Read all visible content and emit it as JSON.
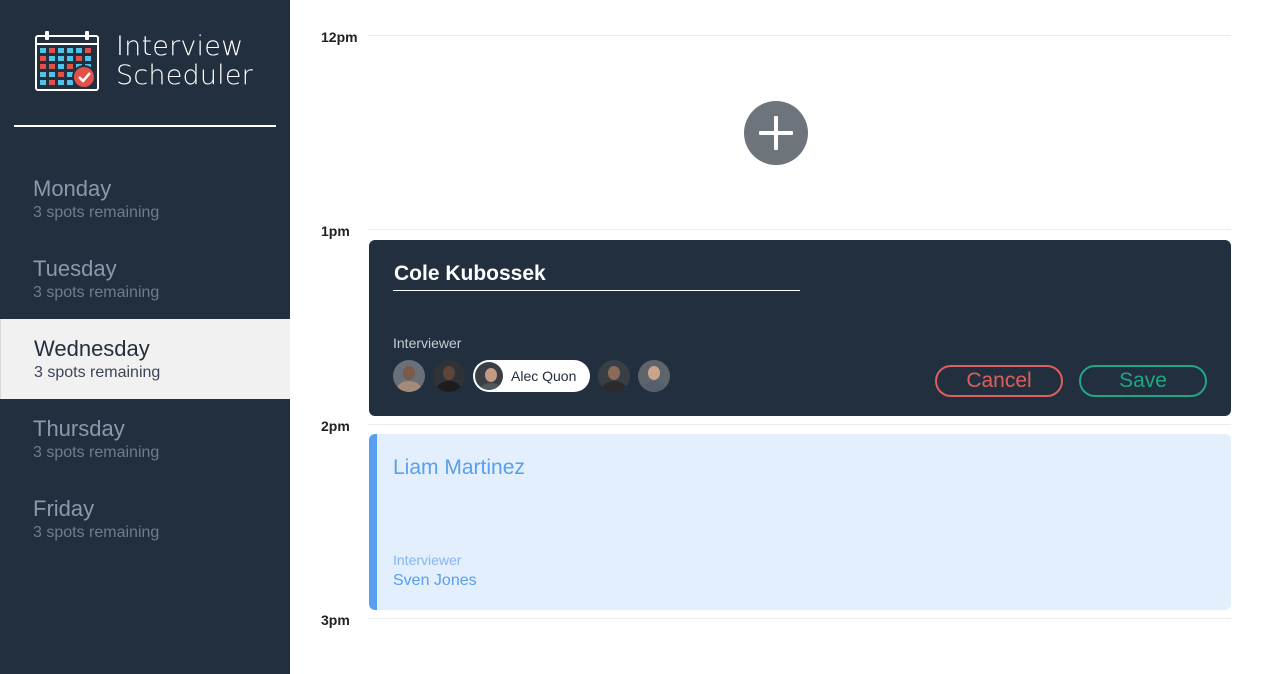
{
  "app": {
    "title_line1": "Interview",
    "title_line2": "Scheduler",
    "logo_icon": "calendar-check-icon"
  },
  "days": [
    {
      "name": "Monday",
      "spots": "3 spots remaining",
      "selected": false
    },
    {
      "name": "Tuesday",
      "spots": "3 spots remaining",
      "selected": false
    },
    {
      "name": "Wednesday",
      "spots": "3 spots remaining",
      "selected": true
    },
    {
      "name": "Thursday",
      "spots": "3 spots remaining",
      "selected": false
    },
    {
      "name": "Friday",
      "spots": "3 spots remaining",
      "selected": false
    }
  ],
  "schedule": {
    "times": [
      "12pm",
      "1pm",
      "2pm",
      "3pm"
    ],
    "add_icon": "plus-icon"
  },
  "form": {
    "student_name": "Cole Kubossek",
    "interviewer_label": "Interviewer",
    "interviewers": [
      {
        "name": "",
        "selected": false,
        "skin": "#7a5a48",
        "shirt": "#a58a7a"
      },
      {
        "name": "",
        "selected": false,
        "skin": "#5d4538",
        "shirt": "#1c1c1c"
      },
      {
        "name": "Alec Quon",
        "selected": true,
        "skin": "#c49a80",
        "shirt": "#4f5660"
      },
      {
        "name": "",
        "selected": false,
        "skin": "#8b6b58",
        "shirt": "#2b2b2b"
      },
      {
        "name": "",
        "selected": false,
        "skin": "#c9a58c",
        "shirt": "#55606c"
      }
    ],
    "cancel_label": "Cancel",
    "save_label": "Save"
  },
  "appointment": {
    "student": "Liam Martinez",
    "interviewer_label": "Interviewer",
    "interviewer": "Sven Jones"
  },
  "colors": {
    "sidebar": "#222f3e",
    "cancel": "#df5f5a",
    "save": "#1fa783",
    "appointment_accent": "#5a9ef0"
  }
}
